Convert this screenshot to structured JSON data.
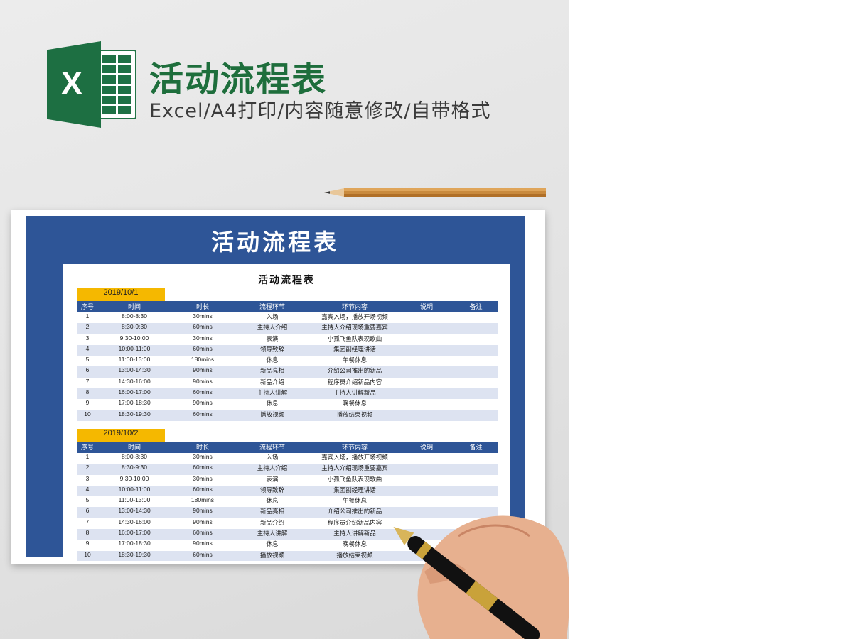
{
  "hero": {
    "title": "活动流程表",
    "subtitle": "Excel/A4打印/内容随意修改/自带格式",
    "logo_letter": "X"
  },
  "sheet": {
    "banner_title": "活动流程表",
    "title": "活动流程表",
    "columns": [
      "序号",
      "时间",
      "时长",
      "流程环节",
      "环节内容",
      "说明",
      "备注"
    ],
    "sections": [
      {
        "date": "2019/10/1",
        "rows": [
          [
            "1",
            "8:00-8:30",
            "30mins",
            "入场",
            "嘉宾入场，播放开场视频",
            "",
            ""
          ],
          [
            "2",
            "8:30-9:30",
            "60mins",
            "主持人介绍",
            "主持人介绍现场重要嘉宾",
            "",
            ""
          ],
          [
            "3",
            "9:30-10:00",
            "30mins",
            "表演",
            "小孤飞鱼队表现歌曲",
            "",
            ""
          ],
          [
            "4",
            "10:00-11:00",
            "60mins",
            "领导致辞",
            "集团副经理讲话",
            "",
            ""
          ],
          [
            "5",
            "11:00-13:00",
            "180mins",
            "休息",
            "午餐休息",
            "",
            ""
          ],
          [
            "6",
            "13:00-14:30",
            "90mins",
            "新品亮相",
            "介绍公司推出的新品",
            "",
            ""
          ],
          [
            "7",
            "14:30-16:00",
            "90mins",
            "新品介绍",
            "程序员介绍新品内容",
            "",
            ""
          ],
          [
            "8",
            "16:00-17:00",
            "60mins",
            "主持人讲解",
            "主持人讲解新品",
            "",
            ""
          ],
          [
            "9",
            "17:00-18:30",
            "90mins",
            "休息",
            "晚餐休息",
            "",
            ""
          ],
          [
            "10",
            "18:30-19:30",
            "60mins",
            "播放视频",
            "播放结束视频",
            "",
            ""
          ]
        ]
      },
      {
        "date": "2019/10/2",
        "rows": [
          [
            "1",
            "8:00-8:30",
            "30mins",
            "入场",
            "嘉宾入场，播放开场视频",
            "",
            ""
          ],
          [
            "2",
            "8:30-9:30",
            "60mins",
            "主持人介绍",
            "主持人介绍现场重要嘉宾",
            "",
            ""
          ],
          [
            "3",
            "9:30-10:00",
            "30mins",
            "表演",
            "小孤飞鱼队表现歌曲",
            "",
            ""
          ],
          [
            "4",
            "10:00-11:00",
            "60mins",
            "领导致辞",
            "集团副经理讲话",
            "",
            ""
          ],
          [
            "5",
            "11:00-13:00",
            "180mins",
            "休息",
            "午餐休息",
            "",
            ""
          ],
          [
            "6",
            "13:00-14:30",
            "90mins",
            "新品亮相",
            "介绍公司推出的新品",
            "",
            ""
          ],
          [
            "7",
            "14:30-16:00",
            "90mins",
            "新品介绍",
            "程序员介绍新品内容",
            "",
            ""
          ],
          [
            "8",
            "16:00-17:00",
            "60mins",
            "主持人讲解",
            "主持人讲解新品",
            "",
            ""
          ],
          [
            "9",
            "17:00-18:30",
            "90mins",
            "休息",
            "晚餐休息",
            "",
            ""
          ],
          [
            "10",
            "18:30-19:30",
            "60mins",
            "播放视频",
            "播放结束视频",
            "",
            ""
          ]
        ]
      }
    ]
  },
  "colors": {
    "brand_green": "#1e6e3c",
    "frame_blue": "#2e5597",
    "row_alt": "#dde3f1",
    "date_tag": "#f5b800"
  },
  "icons": [
    "excel-logo-icon",
    "pencil-icon",
    "hand-with-pen-icon"
  ]
}
